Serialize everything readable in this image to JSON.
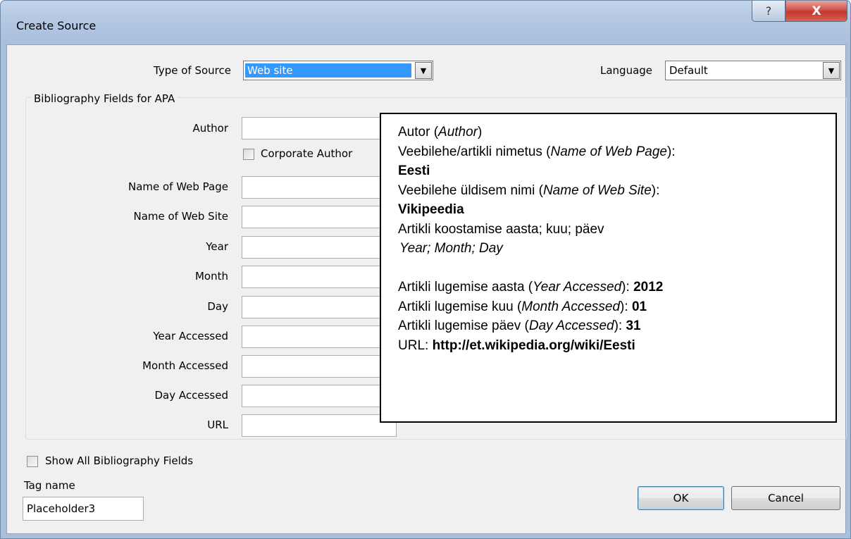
{
  "window": {
    "title": "Create Source",
    "help_glyph": "?",
    "close_glyph": "X"
  },
  "source_type": {
    "label": "Type of Source",
    "value": "Web site"
  },
  "language": {
    "label": "Language",
    "value": "Default"
  },
  "group_title": "Bibliography Fields for APA",
  "fields": {
    "author": "Author",
    "corporate_author": "Corporate Author",
    "name_of_web_page": "Name of Web Page",
    "name_of_web_site": "Name of Web Site",
    "year": "Year",
    "month": "Month",
    "day": "Day",
    "year_accessed": "Year Accessed",
    "month_accessed": "Month Accessed",
    "day_accessed": "Day Accessed",
    "url": "URL"
  },
  "show_all_fields": "Show All Bibliography Fields",
  "tag": {
    "label": "Tag name",
    "value": "Placeholder3"
  },
  "buttons": {
    "ok": "OK",
    "cancel": "Cancel"
  },
  "note": {
    "l1a": "Autor (",
    "l1b": "Author",
    "l1c": ")",
    "l2a": "Veebilehe/artikli nimetus (",
    "l2b": "Name of Web Page",
    "l2c": "):",
    "l3": "Eesti",
    "l4a": "Veebilehe üldisem nimi (",
    "l4b": "Name of Web Site",
    "l4c": "):",
    "l5": "Vikipeedia",
    "l6": "Artikli koostamise aasta; kuu; päev",
    "l7": "Year; Month; Day",
    "l8a": "Artikli lugemise aasta (",
    "l8b": "Year Accessed",
    "l8c": "): ",
    "l8d": "2012",
    "l9a": "Artikli lugemise kuu (",
    "l9b": "Month Accessed",
    "l9c": "): ",
    "l9d": "01",
    "l10a": "Artikli lugemise päev (",
    "l10b": "Day Accessed",
    "l10c": "): ",
    "l10d": "31",
    "l11a": "URL: ",
    "l11b": "http://et.wikipedia.org/wiki/Eesti"
  },
  "colors": {
    "selection": "#3399ff",
    "close_button": "#c1392f",
    "dialog_face": "#f0f0f0"
  }
}
